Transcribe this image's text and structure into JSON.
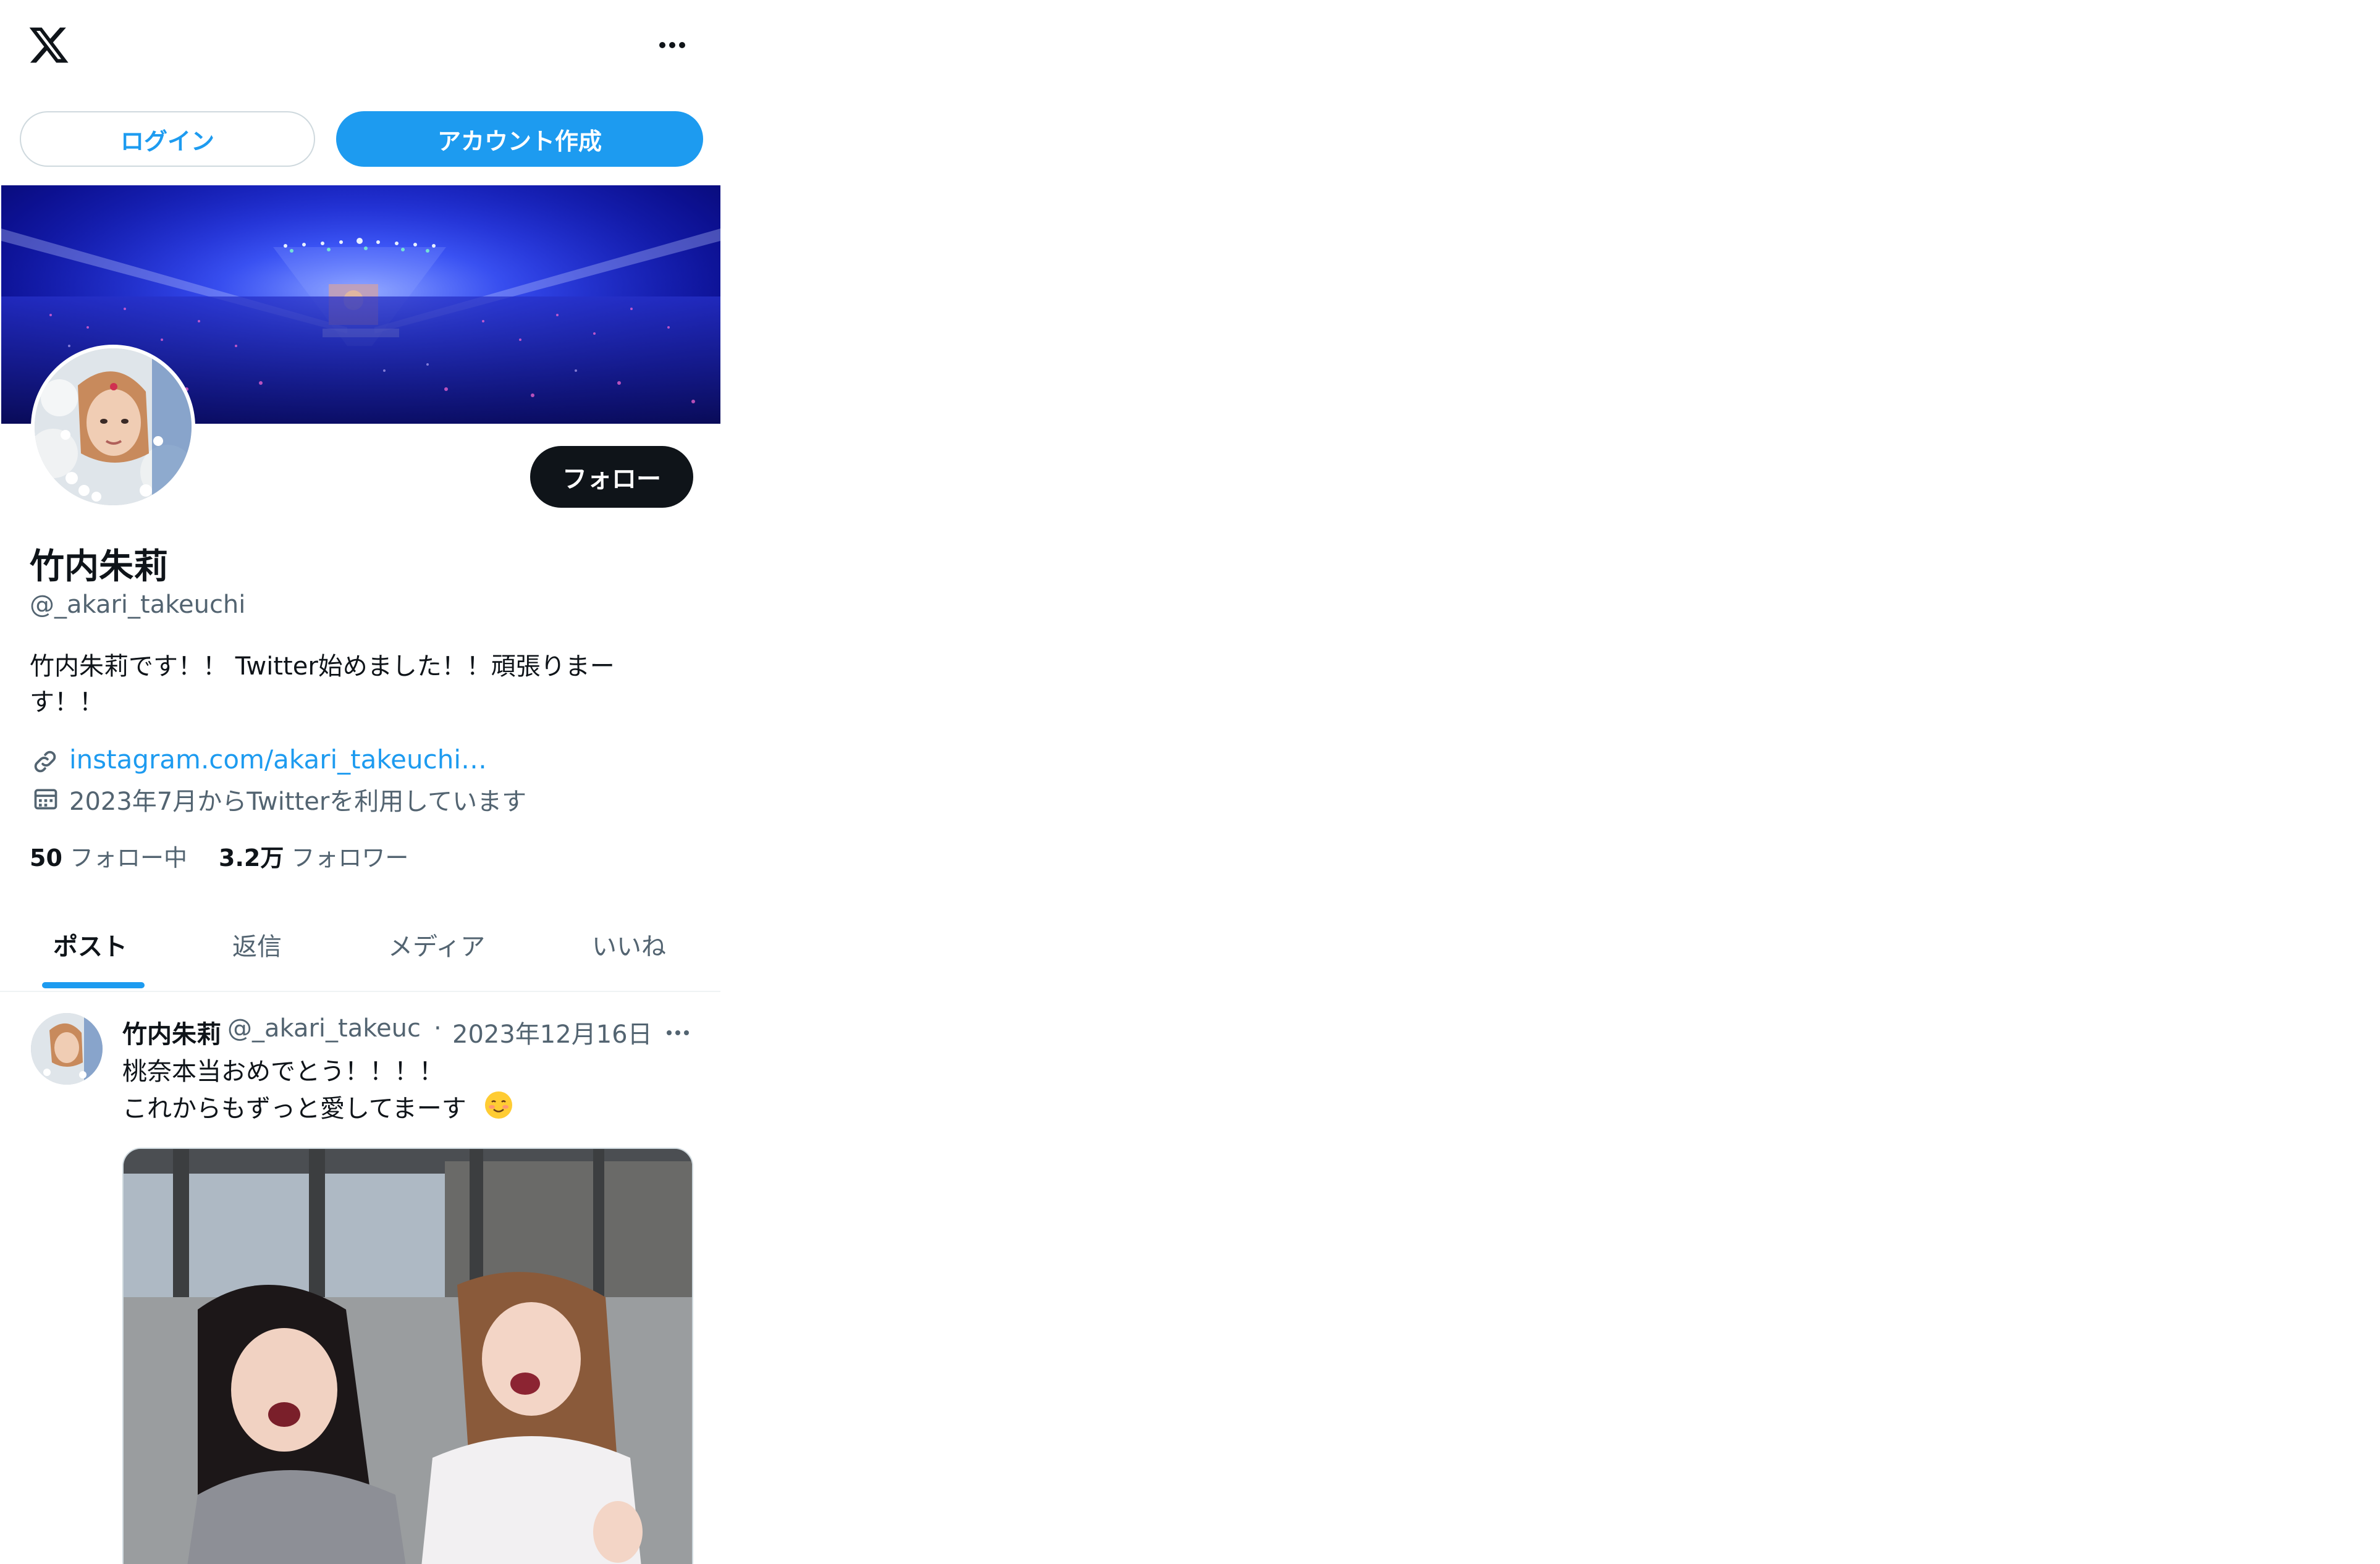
{
  "topbar": {
    "logo_icon": "x-logo-icon",
    "more_icon": "more-horizontal-icon"
  },
  "auth": {
    "login_label": "ログイン",
    "signup_label": "アカウント作成"
  },
  "profile": {
    "display_name": "竹内朱莉",
    "handle": "@_akari_takeuchi",
    "bio": "竹内朱莉です！！ Twitter始めました！！頑張りまーす！！",
    "follow_label": "フォロー",
    "link_text": "instagram.com/akari_takeuchi…",
    "joined_text": "2023年7月からTwitterを利用しています",
    "following_count": "50",
    "following_label": "フォロー中",
    "followers_count": "3.2万",
    "followers_label": "フォロワー"
  },
  "tabs": [
    {
      "label": "ポスト",
      "active": true
    },
    {
      "label": "返信",
      "active": false
    },
    {
      "label": "メディア",
      "active": false
    },
    {
      "label": "いいね",
      "active": false
    }
  ],
  "post": {
    "author_name": "竹内朱莉",
    "author_handle": "@_akari_takeuc",
    "separator": "·",
    "date": "2023年12月16日",
    "text_line_1": "桃奈本当おめでとう！！！！",
    "text_line_2": "これからもずっと愛してまーす",
    "emoji_icon": "smiling-face-with-blush-emoji"
  },
  "colors": {
    "accent": "#1d9bf0",
    "text_primary": "#0f1419",
    "text_secondary": "#536471",
    "border": "#cfd9de"
  }
}
